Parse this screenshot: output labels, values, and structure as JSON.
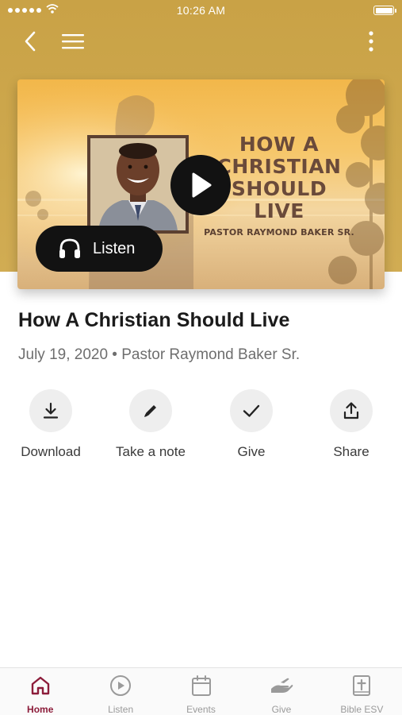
{
  "status_bar": {
    "time": "10:26 AM"
  },
  "nav": {
    "back_icon": "chevron-left-icon",
    "menu_icon": "hamburger-menu-icon",
    "more_icon": "vertical-ellipsis-icon"
  },
  "hero": {
    "artwork_title": "HOW A CHRISTIAN SHOULD LIVE",
    "artwork_subtitle": "PASTOR RAYMOND BAKER SR.",
    "play_icon": "play-icon",
    "listen_label": "Listen"
  },
  "sermon": {
    "title": "How A Christian Should Live",
    "meta": "July 19, 2020 • Pastor Raymond Baker Sr."
  },
  "actions": [
    {
      "label": "Download",
      "icon": "download-icon"
    },
    {
      "label": "Take a note",
      "icon": "pencil-icon"
    },
    {
      "label": "Give",
      "icon": "checkmark-icon"
    },
    {
      "label": "Share",
      "icon": "share-icon"
    }
  ],
  "tabs": [
    {
      "label": "Home",
      "icon": "home-icon",
      "active": true
    },
    {
      "label": "Listen",
      "icon": "play-circle-icon",
      "active": false
    },
    {
      "label": "Events",
      "icon": "calendar-icon",
      "active": false
    },
    {
      "label": "Give",
      "icon": "giving-hand-icon",
      "active": false
    },
    {
      "label": "Bible ESV",
      "icon": "bible-icon",
      "active": false
    }
  ],
  "colors": {
    "header_gold": "#c9a246",
    "active_tab": "#8c1c3a",
    "inactive_tab": "#9a9a9a",
    "dark_button": "#121212"
  }
}
